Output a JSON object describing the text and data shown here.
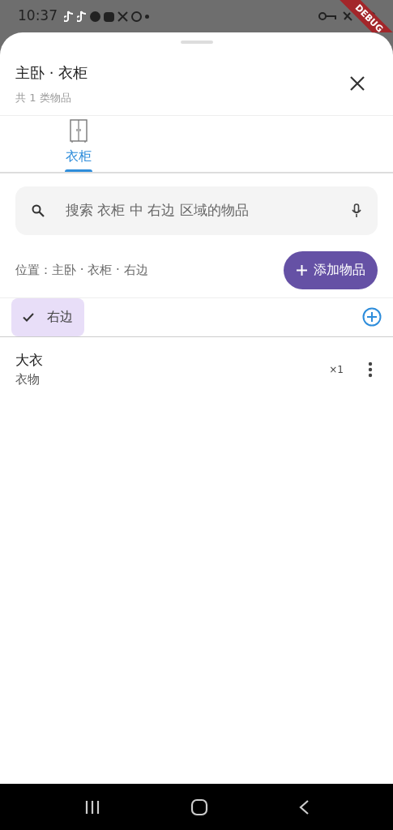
{
  "status_bar": {
    "time": "10:37"
  },
  "debug_banner": "DEBUG",
  "sheet": {
    "title": "主卧 · 衣柜",
    "subtitle": "共 1 类物品"
  },
  "tabs": [
    {
      "label": "衣柜",
      "selected": true
    }
  ],
  "search": {
    "placeholder": "搜索 衣柜 中 右边 区域的物品"
  },
  "location": "位置：主卧 · 衣柜 · 右边",
  "add_button": "添加物品",
  "chips": [
    {
      "label": "右边",
      "selected": true
    }
  ],
  "items": [
    {
      "name": "大衣",
      "category": "衣物",
      "quantity": "×1"
    }
  ]
}
